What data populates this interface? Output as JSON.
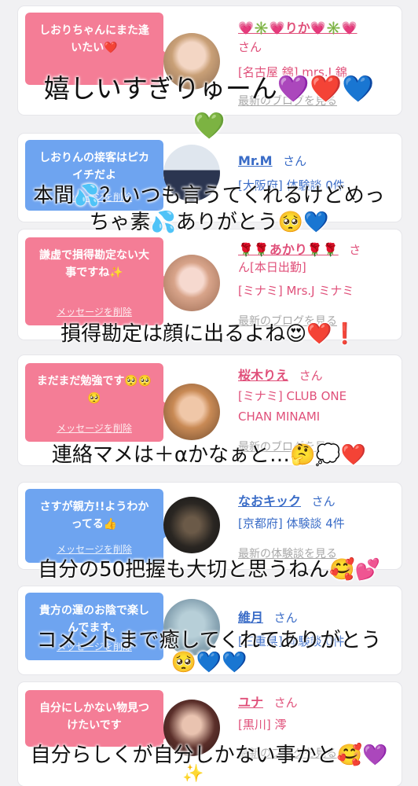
{
  "cards": [
    {
      "bubble": "しおりちゃんにまた逢いたい❤️",
      "delete_label": "",
      "name": "💗✳️💗りか💗✳️💗",
      "san": "さん",
      "info1": "[名古屋 錦] mrs.J 錦",
      "info2": "",
      "link": "最新のブログを見る"
    },
    {
      "bubble": "しおりんの接客はピカイチだよ",
      "delete_label": "メッセージを削除",
      "name": "Mr.M",
      "san": "さん",
      "info1": "[大阪府] 体験談 0件",
      "info2": "",
      "link": ""
    },
    {
      "bubble": "謙虚で損得勘定ない大事ですね✨",
      "delete_label": "メッセージを削除",
      "name": "🌹🌹あかり🌹🌹",
      "san": "さ",
      "info1": "ん[本日出勤]",
      "info2": "[ミナミ] Mrs.J ミナミ",
      "link": "最新のブログを見る"
    },
    {
      "bubble": "まだまだ勉強です🥺🥺🥺",
      "delete_label": "メッセージを削除",
      "name": "桜木りえ",
      "san": "さん",
      "info1": "[ミナミ] CLUB ONE",
      "info2": "CHAN MINAMI",
      "link": "最新のブログを見る"
    },
    {
      "bubble": "さすが親方!!ようわかってる👍",
      "delete_label": "メッセージを削除",
      "name": "なおキック",
      "san": "さん",
      "info1": "[京都府] 体験談 4件",
      "info2": "",
      "link": "最新の体験談を見る"
    },
    {
      "bubble": "貴方の運のお陰で楽しんでます。",
      "delete_label": "メッセージを削除",
      "name": "維月",
      "san": "さん",
      "info1": "[三重県] 体験談 0件",
      "info2": "",
      "link": ""
    },
    {
      "bubble": "自分にしかない物見つけたいです",
      "delete_label": "",
      "name": "ユナ",
      "san": "さん",
      "info1": "[黒川] 澪",
      "info2": "",
      "link": "最新のブログを見る"
    }
  ],
  "overlays": [
    "嬉しいすぎりゅーん💜❤️💙",
    "💚",
    "本間💦？いつも言うてくれるけどめっ",
    "ちゃ素💦ありがとう🥺💙",
    "損得勘定は顔に出るよね😍❤️❗️",
    "連絡マメは＋αかなぁと…🤔💭❤️",
    "自分の50把握も大切と思うねん🥰💕",
    "コメントまで癒してくれてありがとう",
    "🥺💙💙",
    "自分らしくが自分しかない事かと🥰💜",
    "✨"
  ]
}
